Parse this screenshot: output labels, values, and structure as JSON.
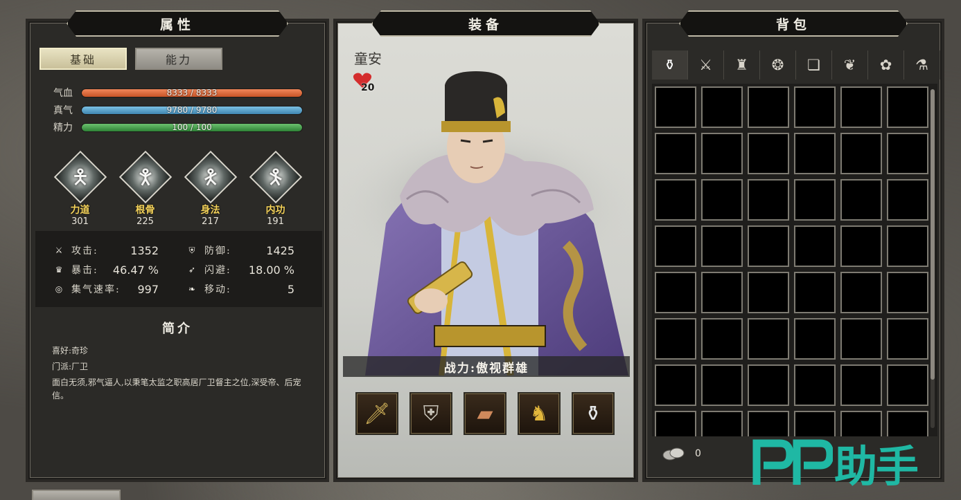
{
  "left_panel": {
    "title": "属性",
    "tabs": [
      {
        "label": "基础",
        "active": true
      },
      {
        "label": "能力",
        "active": false
      }
    ],
    "bars": [
      {
        "label": "气血",
        "text": "8333 / 8333",
        "fill": 1.0,
        "color": "#e26a3c"
      },
      {
        "label": "真气",
        "text": "9780 / 9780",
        "fill": 1.0,
        "color": "#5aa6cf"
      },
      {
        "label": "精力",
        "text": "100 / 100",
        "fill": 1.0,
        "color": "#4da352"
      }
    ],
    "attributes": [
      {
        "name": "力道",
        "value": "301",
        "icon": "strength-figure-icon"
      },
      {
        "name": "根骨",
        "value": "225",
        "icon": "constitution-figure-icon"
      },
      {
        "name": "身法",
        "value": "217",
        "icon": "agility-figure-icon"
      },
      {
        "name": "内功",
        "value": "191",
        "icon": "inner-power-figure-icon"
      }
    ],
    "combat": [
      {
        "label": "攻击:",
        "value": "1352",
        "icon": "sword-icon"
      },
      {
        "label": "防御:",
        "value": "1425",
        "icon": "armor-icon"
      },
      {
        "label": "暴击:",
        "value": "46.47 %",
        "icon": "crit-icon"
      },
      {
        "label": "闪避:",
        "value": "18.00 %",
        "icon": "dodge-icon"
      },
      {
        "label": "集气速率:",
        "value": "997",
        "icon": "qi-rate-icon"
      },
      {
        "label": "移动:",
        "value": "5",
        "icon": "move-icon"
      }
    ],
    "intro": {
      "title": "简介",
      "hobby": "喜好:奇珍",
      "sect": "门派:厂卫",
      "description": "面白无须,邪气逼人,以秉笔太监之职高居厂卫督主之位,深受帝、后宠信。"
    }
  },
  "middle_panel": {
    "title": "装备",
    "character_name": "童安",
    "favor": "20",
    "power_label": "战力:傲视群雄",
    "equipment": [
      {
        "item": "sword",
        "icon": "sword-item-icon"
      },
      {
        "item": "armor",
        "icon": "armor-item-icon"
      },
      {
        "item": "vambrace",
        "icon": "vambrace-item-icon"
      },
      {
        "item": "boots",
        "icon": "boots-item-icon"
      },
      {
        "item": "gourd",
        "icon": "gourd-item-icon"
      }
    ]
  },
  "right_panel": {
    "title": "背包",
    "tabs": [
      {
        "icon": "all-items-icon",
        "glyph": "⚱",
        "active": true
      },
      {
        "icon": "weapons-icon",
        "glyph": "⚔",
        "active": false
      },
      {
        "icon": "armor-icon",
        "glyph": "♜",
        "active": false
      },
      {
        "icon": "accessory-icon",
        "glyph": "❂",
        "active": false
      },
      {
        "icon": "book-icon",
        "glyph": "❏",
        "active": false
      },
      {
        "icon": "herb-icon",
        "glyph": "❦",
        "active": false
      },
      {
        "icon": "lotus-icon",
        "glyph": "✿",
        "active": false
      },
      {
        "icon": "misc-icon",
        "glyph": "⚗",
        "active": false
      }
    ],
    "grid_rows": 8,
    "grid_cols": 6,
    "money": "0"
  },
  "watermark": {
    "latin": "PP",
    "cjk": "助手",
    "color": "#1fb8a4"
  }
}
